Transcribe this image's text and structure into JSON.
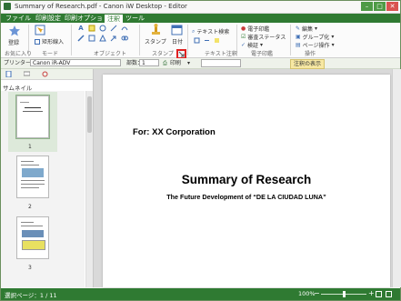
{
  "window": {
    "title": "Summary of Research.pdf - Canon iW Desktop - Editor"
  },
  "tabs": [
    "ファイル",
    "印刷設定",
    "印刷オプション",
    "注釈",
    "ツール"
  ],
  "active_tab": "注釈",
  "ribbon": {
    "groups": [
      "お気に入り",
      "モード",
      "オブジェクト",
      "スタンプ",
      "テキスト注釈",
      "電子印鑑",
      "操作"
    ],
    "favorite_label": "登録",
    "mode_label": "矩形線入",
    "stamp_label": "スタンプ",
    "date_label": "日付",
    "text_search_label": "テキスト検索",
    "e_seal_label": "電子印鑑",
    "review_status_label": "審査ステータス",
    "verify_label": "検証",
    "edit_label": "編集",
    "group_label": "グループ化",
    "page_op_label": "ページ操作"
  },
  "toolbar2": {
    "printer_label": "プリンター：",
    "printer_value": "Canon iR-ADV",
    "copies_label": "部数：",
    "copies_value": "1",
    "print_label": "印刷",
    "annot_label": "注釈の表示"
  },
  "sidebar": {
    "header": "サムネイル",
    "pages": [
      "1",
      "2",
      "3"
    ]
  },
  "document": {
    "for_line": "For: XX Corporation",
    "title": "Summary of Research",
    "subtitle": "The Future Development of “DE LA CIUDAD LUNA”"
  },
  "status": {
    "page_info": "選択ページ：1 / 11",
    "zoom": "100%"
  },
  "colors": {
    "accent": "#2f7a32",
    "highlight": "#e02020"
  }
}
